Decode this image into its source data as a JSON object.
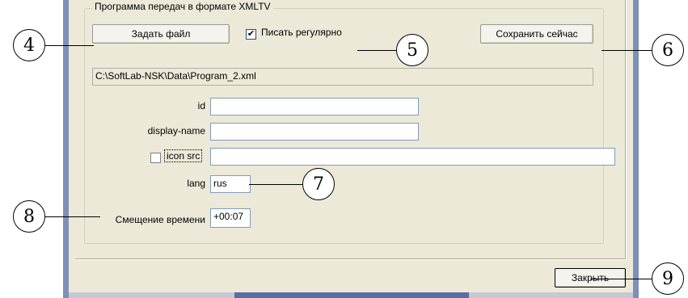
{
  "group": {
    "title": "Программа передач в формате XMLTV",
    "set_file_label": "Задать файл",
    "write_regularly": {
      "label": "Писать регулярно",
      "checked": true
    },
    "save_now_label": "Сохранить сейчас",
    "file_path": "C:\\SoftLab-NSK\\Data\\Program_2.xml",
    "fields": {
      "id": {
        "label": "id",
        "value": ""
      },
      "display_name": {
        "label": "display-name",
        "value": ""
      },
      "icon_src": {
        "label": "icon src",
        "value": "",
        "checked": false
      },
      "lang": {
        "label": "lang",
        "value": "rus"
      }
    },
    "time_offset": {
      "label": "Смещение времени",
      "value": "+00:07"
    }
  },
  "footer": {
    "close_label": "Закрыть"
  },
  "callouts": {
    "c4": "4",
    "c5": "5",
    "c6": "6",
    "c7": "7",
    "c8": "8",
    "c9": "9"
  }
}
